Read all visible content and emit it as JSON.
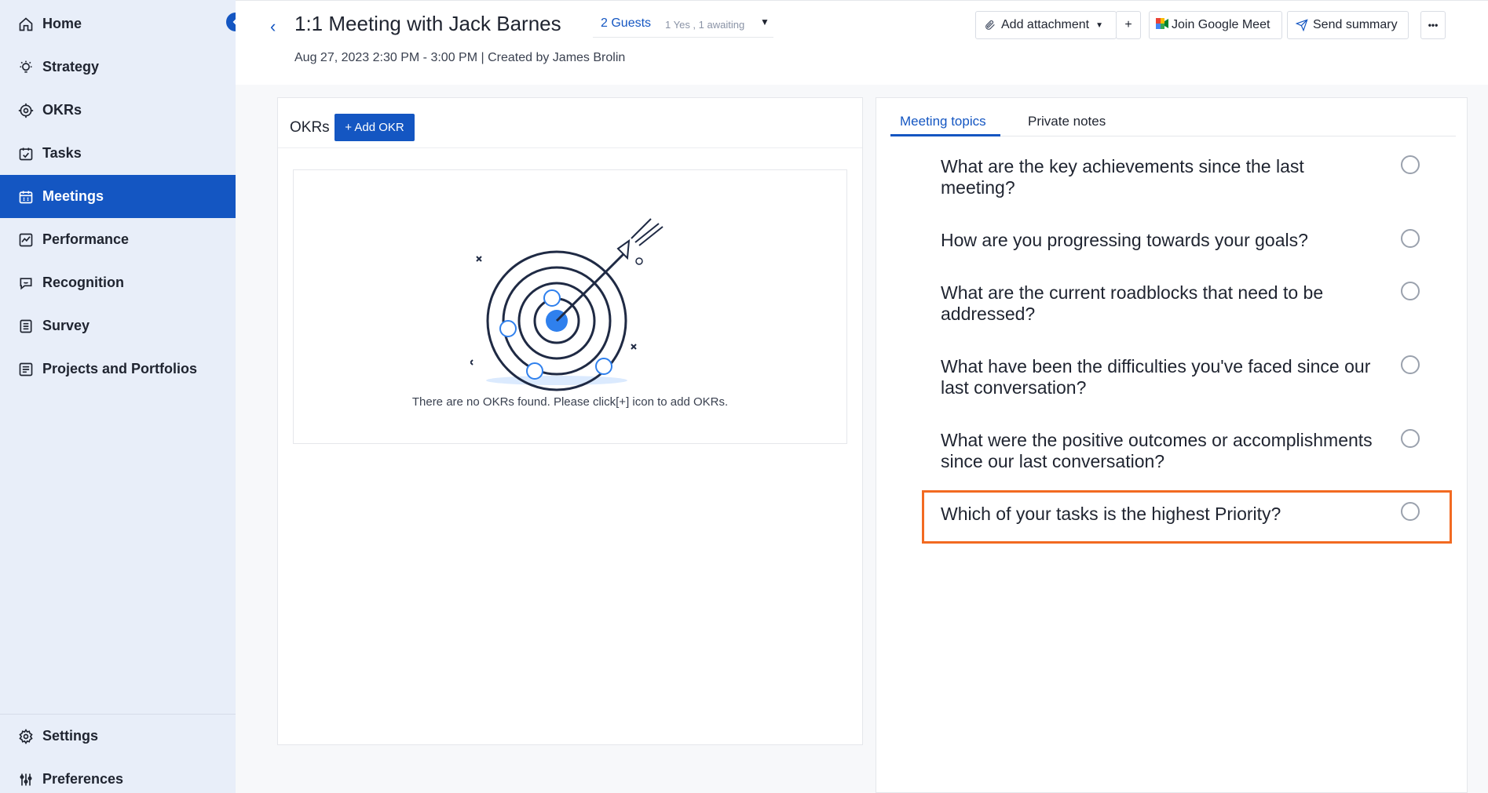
{
  "sidebar": {
    "items": [
      {
        "label": "Home",
        "icon": "home-icon"
      },
      {
        "label": "Strategy",
        "icon": "lightbulb-icon"
      },
      {
        "label": "OKRs",
        "icon": "target-icon"
      },
      {
        "label": "Tasks",
        "icon": "tasks-icon"
      },
      {
        "label": "Meetings",
        "icon": "calendar-icon",
        "active": true
      },
      {
        "label": "Performance",
        "icon": "chart-icon"
      },
      {
        "label": "Recognition",
        "icon": "chat-icon"
      },
      {
        "label": "Survey",
        "icon": "survey-icon"
      },
      {
        "label": "Projects and Portfolios",
        "icon": "projects-icon"
      }
    ],
    "bottom": [
      {
        "label": "Settings",
        "icon": "gear-icon"
      },
      {
        "label": "Preferences",
        "icon": "sliders-icon"
      }
    ]
  },
  "header": {
    "title": "1:1 Meeting with Jack Barnes",
    "guests": "2 Guests",
    "rsvp": "1 Yes , 1 awaiting",
    "subtitle": "Aug 27, 2023 2:30 PM - 3:00 PM | Created by James Brolin",
    "add_attachment": "Add attachment",
    "plus": "+",
    "join_meet": "Join Google Meet",
    "send_summary": "Send summary",
    "more": "•••"
  },
  "okrs": {
    "label": "OKRs",
    "add_button": "+ Add OKR",
    "empty_text": "There are no OKRs found. Please click[+] icon to add OKRs."
  },
  "topics": {
    "tabs": [
      "Meeting topics",
      "Private notes"
    ],
    "items": [
      "What are the key achievements since the last meeting?",
      "How are you progressing towards your goals?",
      "What are the current roadblocks that need to be addressed?",
      "What have been the difficulties you've faced since our last conversation?",
      "What were the positive outcomes or accomplishments since our last conversation?",
      "Which of your tasks is the highest Priority?"
    ]
  },
  "colors": {
    "accent": "#1456c2",
    "sidebar_bg": "#e8eef9",
    "highlight": "#f26a21"
  }
}
